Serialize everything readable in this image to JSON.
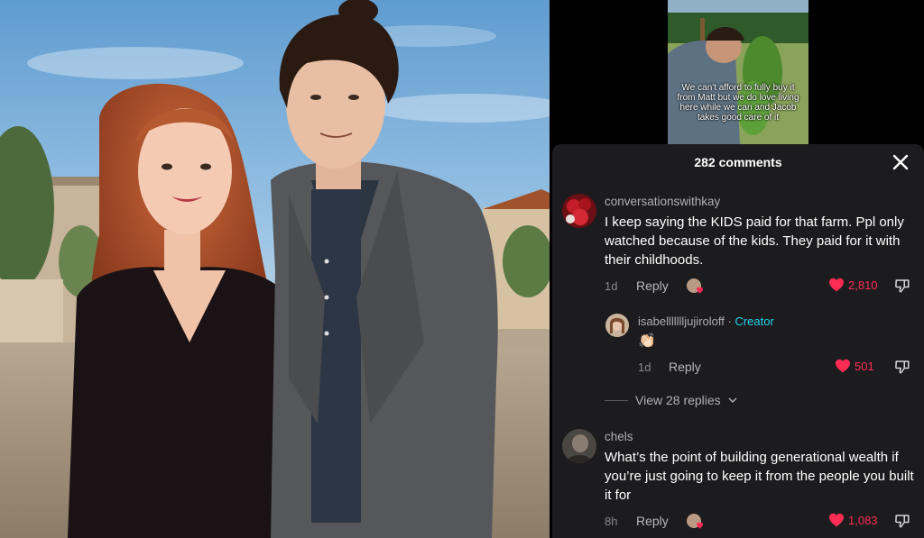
{
  "video_caption": "We can't afford to fully buy it from Matt but we do love living here while we can and Jacob takes good care of it",
  "comments_header": {
    "count_label": "282 comments"
  },
  "comments": [
    {
      "username": "conversationswithkay",
      "text": "I keep saying the KIDS paid for that farm. Ppl only watched because of the kids. They paid for it with their childhoods.",
      "time": "1d",
      "reply_label": "Reply",
      "likes": "2,810"
    },
    {
      "username": "isabellllllljujiroloff",
      "badge_separator": "·",
      "badge": "Creator",
      "text": "👏🏻",
      "time": "1d",
      "reply_label": "Reply",
      "likes": "501"
    },
    {
      "username": "chels",
      "text": "What’s the point of building generational wealth if you’re just going to keep it from the people you built it for",
      "time": "8h",
      "reply_label": "Reply",
      "likes": "1,083"
    }
  ],
  "view_replies_label": "View 28 replies",
  "colors": {
    "like": "#fe2c55",
    "creator": "#20d5ec",
    "sheet_bg": "#1c1c1e"
  },
  "icons": [
    "close-icon",
    "heart-icon",
    "dislike-icon",
    "chevron-down-icon"
  ]
}
